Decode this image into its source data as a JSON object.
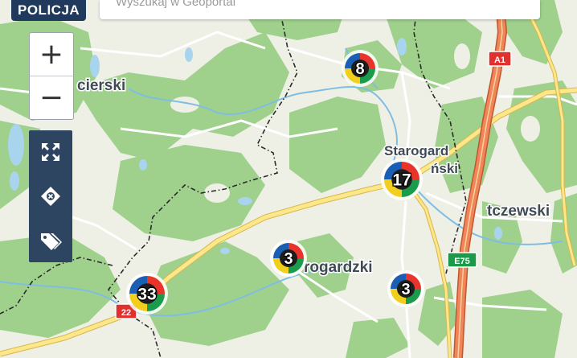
{
  "header": {
    "badge_label": "POLICJA"
  },
  "search": {
    "value": "Wyszukaj w Geoportal"
  },
  "zoom": {
    "in_label": "+",
    "out_label": "−"
  },
  "tools": [
    "fullscreen-icon",
    "locate-icon",
    "tags-icon"
  ],
  "place_labels": {
    "koscierski": "cierski",
    "starogard_line1": "Starogard",
    "starogard_line2": "ński",
    "tczewski": "tczewski",
    "starogardzki": "rogardzki"
  },
  "road_shields": {
    "a1": "A1",
    "e75": "E75",
    "r22": "22"
  },
  "clusters": [
    {
      "id": "cluster-8",
      "count": "8"
    },
    {
      "id": "cluster-17",
      "count": "17"
    },
    {
      "id": "cluster-3-west",
      "count": "3"
    },
    {
      "id": "cluster-3-east",
      "count": "3"
    },
    {
      "id": "cluster-33",
      "count": "33"
    }
  ],
  "colors": {
    "forest": "#9fd08c",
    "open_land": "#eef0e6",
    "water": "#a9d4ee",
    "motorway": "#f0855a",
    "main_road": "#fce78a",
    "badge": "#1f3a5c",
    "shield_red": "#e0312f",
    "shield_green": "#1a9a4a"
  }
}
